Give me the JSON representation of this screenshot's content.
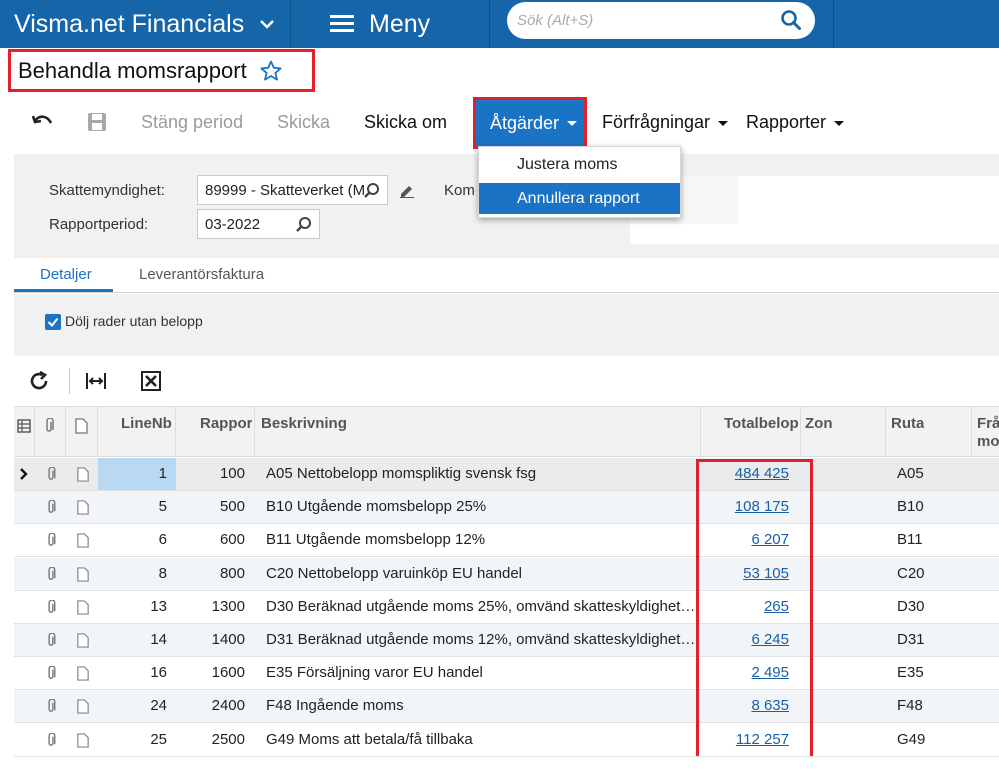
{
  "app": {
    "brand": "Visma.net Financials",
    "menu_label": "Meny",
    "search_placeholder": "Sök (Alt+S)"
  },
  "page": {
    "title": "Behandla momsrapport"
  },
  "toolbar": {
    "close_period": "Stäng period",
    "send": "Skicka",
    "resend": "Skicka om",
    "actions": "Åtgärder",
    "inquiries": "Förfrågningar",
    "reports": "Rapporter"
  },
  "actions_menu": {
    "items": [
      "Justera moms",
      "Annullera rapport"
    ],
    "active_index": 1
  },
  "form": {
    "tax_agency_label": "Skattemyndighet:",
    "tax_agency_value": "89999 - Skatteverket (M",
    "comment_label": "Kom",
    "period_label": "Rapportperiod:",
    "period_value": "03-2022"
  },
  "tabs": {
    "details": "Detaljer",
    "supplier_invoice": "Leverantörsfaktura"
  },
  "options": {
    "hide_zero_rows": "Dölj rader utan belopp",
    "hide_zero_rows_checked": true
  },
  "table": {
    "headers": {
      "line_nbr": "LineNb",
      "report_line": "Rappor",
      "description": "Beskrivning",
      "total": "Totalbelop",
      "zone": "Zon",
      "box": "Ruta",
      "from": "Frå",
      "from2": "mo"
    },
    "rows": [
      {
        "line": "1",
        "report": "100",
        "description": "A05 Nettobelopp momspliktig svensk fsg",
        "total": "484 425",
        "box": "A05"
      },
      {
        "line": "5",
        "report": "500",
        "description": "B10 Utgående momsbelopp 25%",
        "total": "108 175",
        "box": "B10"
      },
      {
        "line": "6",
        "report": "600",
        "description": "B11 Utgående momsbelopp 12%",
        "total": "6 207",
        "box": "B11"
      },
      {
        "line": "8",
        "report": "800",
        "description": "C20 Nettobelopp varuinköp EU handel",
        "total": "53 105",
        "box": "C20"
      },
      {
        "line": "13",
        "report": "1300",
        "description": "D30 Beräknad utgående moms 25%, omvänd skatteskyldighet…",
        "total": "265",
        "box": "D30"
      },
      {
        "line": "14",
        "report": "1400",
        "description": "D31 Beräknad utgående moms 12%, omvänd skatteskyldighet…",
        "total": "6 245",
        "box": "D31"
      },
      {
        "line": "16",
        "report": "1600",
        "description": "E35 Försäljning varor EU handel",
        "total": "2 495",
        "box": "E35"
      },
      {
        "line": "24",
        "report": "2400",
        "description": "F48 Ingående moms",
        "total": "8 635",
        "box": "F48"
      },
      {
        "line": "25",
        "report": "2500",
        "description": "G49 Moms att betala/få tillbaka",
        "total": "112 257",
        "box": "G49"
      }
    ]
  },
  "colors": {
    "topbar": "#1565a8",
    "accent": "#1a73c5",
    "highlight_border": "#e2202b",
    "link": "#1a5ea8"
  }
}
